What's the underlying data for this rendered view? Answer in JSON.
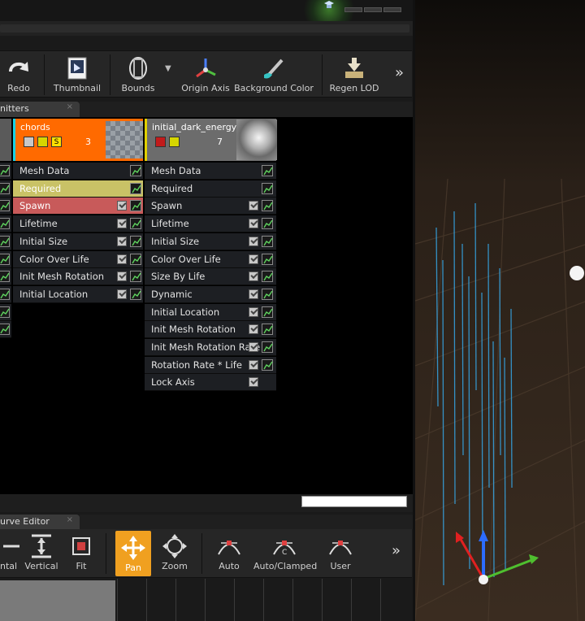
{
  "toolbar": {
    "items": [
      {
        "label": "Redo",
        "icon": "redo-icon"
      },
      {
        "label": "Thumbnail",
        "icon": "thumbnail-icon"
      },
      {
        "label": "Bounds",
        "icon": "bounds-icon"
      },
      {
        "label": "Origin Axis",
        "icon": "origin-axis-icon"
      },
      {
        "label": "Background Color",
        "icon": "background-color-icon"
      },
      {
        "label": "Regen LOD",
        "icon": "regen-lod-icon"
      }
    ],
    "overflow": "»"
  },
  "emitters_tab": {
    "label": "nitters",
    "close": "×"
  },
  "columns": {
    "partial_rows": 10,
    "chords": {
      "name": "chords",
      "count": "3",
      "solo_label": "S",
      "accent": "#ff6a00",
      "modules": [
        {
          "label": "Mesh Data",
          "check": false,
          "style": "normal"
        },
        {
          "label": "Required",
          "check": false,
          "style": "required"
        },
        {
          "label": "Spawn",
          "check": true,
          "style": "spawn"
        },
        {
          "label": "Lifetime",
          "check": true,
          "style": "normal"
        },
        {
          "label": "Initial Size",
          "check": true,
          "style": "normal"
        },
        {
          "label": "Color Over Life",
          "check": true,
          "style": "normal"
        },
        {
          "label": "Init Mesh Rotation",
          "check": true,
          "style": "normal"
        },
        {
          "label": "Initial Location",
          "check": true,
          "style": "normal"
        }
      ]
    },
    "energy": {
      "name": "initial_dark_energy",
      "count": "7",
      "modules": [
        {
          "label": "Mesh Data",
          "check": false,
          "curve": true
        },
        {
          "label": "Required",
          "check": false,
          "curve": true
        },
        {
          "label": "Spawn",
          "check": true,
          "curve": true
        },
        {
          "label": "Lifetime",
          "check": true,
          "curve": true
        },
        {
          "label": "Initial Size",
          "check": true,
          "curve": true
        },
        {
          "label": "Color Over Life",
          "check": true,
          "curve": true
        },
        {
          "label": "Size By Life",
          "check": true,
          "curve": true
        },
        {
          "label": "Dynamic",
          "check": true,
          "curve": true
        },
        {
          "label": "Initial Location",
          "check": true,
          "curve": true
        },
        {
          "label": "Init Mesh Rotation",
          "check": true,
          "curve": true
        },
        {
          "label": "Init Mesh Rotation Rate",
          "check": true,
          "curve": true
        },
        {
          "label": "Rotation Rate * Life",
          "check": true,
          "curve": true
        },
        {
          "label": "Lock Axis",
          "check": true,
          "curve": false
        }
      ]
    }
  },
  "curve_editor": {
    "tab_label": "urve Editor",
    "close": "×",
    "items": [
      {
        "label": "ntal",
        "icon": "horizontal-fit-icon"
      },
      {
        "label": "Vertical",
        "icon": "vertical-fit-icon"
      },
      {
        "label": "Fit",
        "icon": "fit-icon"
      },
      {
        "label": "Pan",
        "icon": "pan-icon",
        "active": true
      },
      {
        "label": "Zoom",
        "icon": "zoom-icon"
      },
      {
        "label": "Auto",
        "icon": "auto-tangent-icon"
      },
      {
        "label": "Auto/Clamped",
        "icon": "auto-clamped-icon"
      },
      {
        "label": "User",
        "icon": "user-tangent-icon"
      }
    ],
    "overflow": "»"
  }
}
